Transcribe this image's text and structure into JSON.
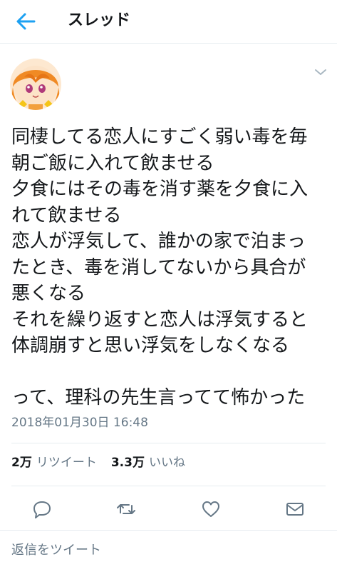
{
  "header": {
    "title": "スレッド"
  },
  "tweet": {
    "lines": [
      "同棲してる恋人にすごく弱い毒を毎",
      "朝ご飯に入れて飲ませる",
      "夕食にはその毒を消す薬を夕食に入",
      "れて飲ませる",
      "恋人が浮気して、誰かの家で泊まっ",
      "たとき、毒を消してないから具合が",
      "悪くなる",
      "それを繰り返すと恋人は浮気すると",
      "体調崩すと思い浮気をしなくなる",
      "",
      "って、理科の先生言ってて怖かった"
    ],
    "timestamp": "2018年01月30日 16:48"
  },
  "stats": {
    "retweets_count": "2万",
    "retweets_label": "リツイート",
    "likes_count": "3.3万",
    "likes_label": "いいね"
  },
  "reply": {
    "placeholder": "返信をツイート"
  },
  "colors": {
    "accent": "#1da1f2",
    "secondary_text": "#657786",
    "divider": "#e6ecf0"
  },
  "icons": {
    "back": "arrow-left-icon",
    "caret": "chevron-down-icon",
    "reply": "speech-bubble-icon",
    "retweet": "retweet-icon",
    "like": "heart-icon",
    "dm": "envelope-icon"
  }
}
